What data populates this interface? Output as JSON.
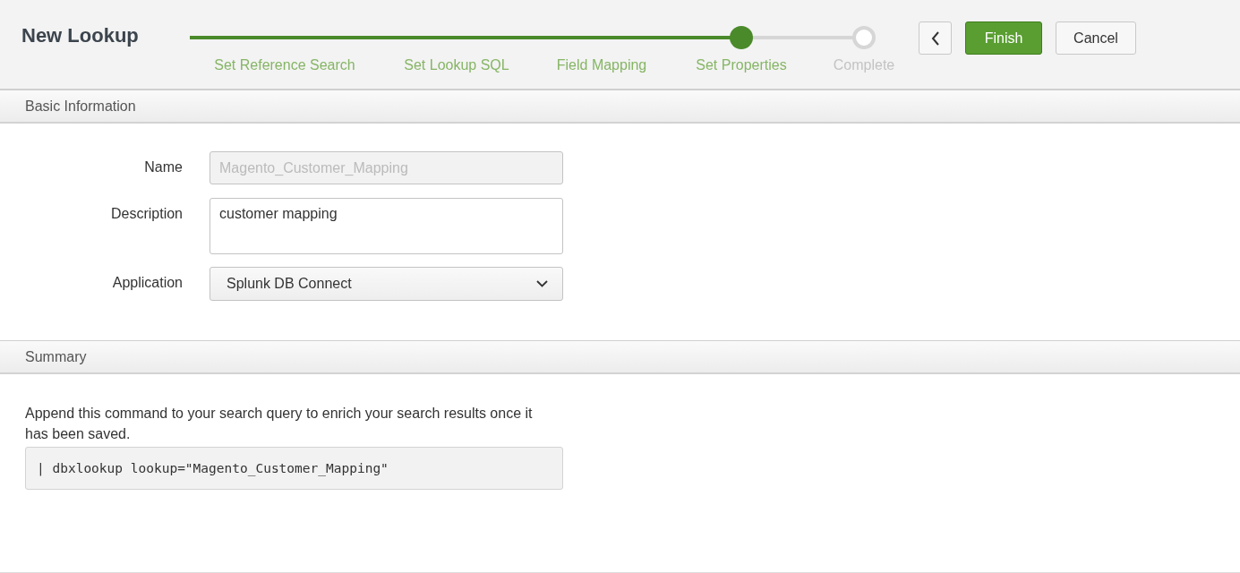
{
  "title": "New Lookup",
  "steps": [
    {
      "label": "Set Reference Search",
      "completed": true,
      "selected": false
    },
    {
      "label": "Set Lookup SQL",
      "completed": true,
      "selected": false
    },
    {
      "label": "Field Mapping",
      "completed": true,
      "selected": false
    },
    {
      "label": "Set Properties",
      "completed": false,
      "selected": true
    },
    {
      "label": "Complete",
      "completed": false,
      "selected": false
    }
  ],
  "buttons": [
    {
      "kind": "back"
    },
    {
      "kind": "primary",
      "label": "Finish"
    },
    {
      "kind": "default",
      "label": "Cancel"
    }
  ],
  "basic_information": {
    "heading": "Basic Information",
    "fields": [
      {
        "kind": "text",
        "label": "Name",
        "value": "Magento_Customer_Mapping",
        "disabled": true
      },
      {
        "kind": "textarea",
        "label": "Description",
        "value": "customer mapping",
        "disabled": false
      },
      {
        "kind": "select",
        "label": "Application",
        "value": "Splunk DB Connect",
        "disabled": false
      }
    ]
  },
  "summary": {
    "heading": "Summary",
    "text": "Append this command to your search query to enrich your search results once it has been saved.",
    "command": "| dbxlookup lookup=\"Magento_Customer_Mapping\""
  }
}
